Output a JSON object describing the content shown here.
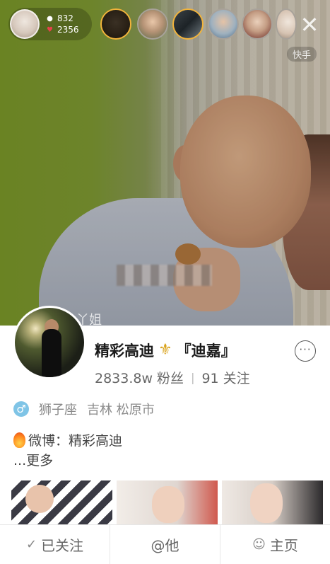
{
  "host": {
    "viewers_count": "832",
    "likes_count": "2356",
    "viewer_icon": "person-icon",
    "likes_icon": "heart-icon"
  },
  "watermark": "快手",
  "chat": {
    "partial_name": "丫姐"
  },
  "profile": {
    "name": "精彩高迪",
    "badge_icon": "fleur-de-lis-icon",
    "badge_text": "『迪嘉』",
    "followers": "2833.8w 粉丝",
    "following": "91 关注",
    "gender_icon": "male-icon",
    "gender_glyph": "♂",
    "zodiac": "狮子座",
    "location": "吉林 松原市",
    "weibo_label": "微博：精彩高迪",
    "more_label": "...更多",
    "more_button": "···"
  },
  "actions": {
    "followed": {
      "icon": "check-icon",
      "glyph": "✓",
      "label": "已关注"
    },
    "mention": {
      "label": "@他"
    },
    "home": {
      "icon": "person-icon",
      "label": "主页"
    }
  },
  "colors": {
    "accent_gold": "#f2b33a",
    "male_blue": "#7fc4e6",
    "text_dark": "#1a1a1a",
    "text_muted": "#8a8a8a"
  }
}
